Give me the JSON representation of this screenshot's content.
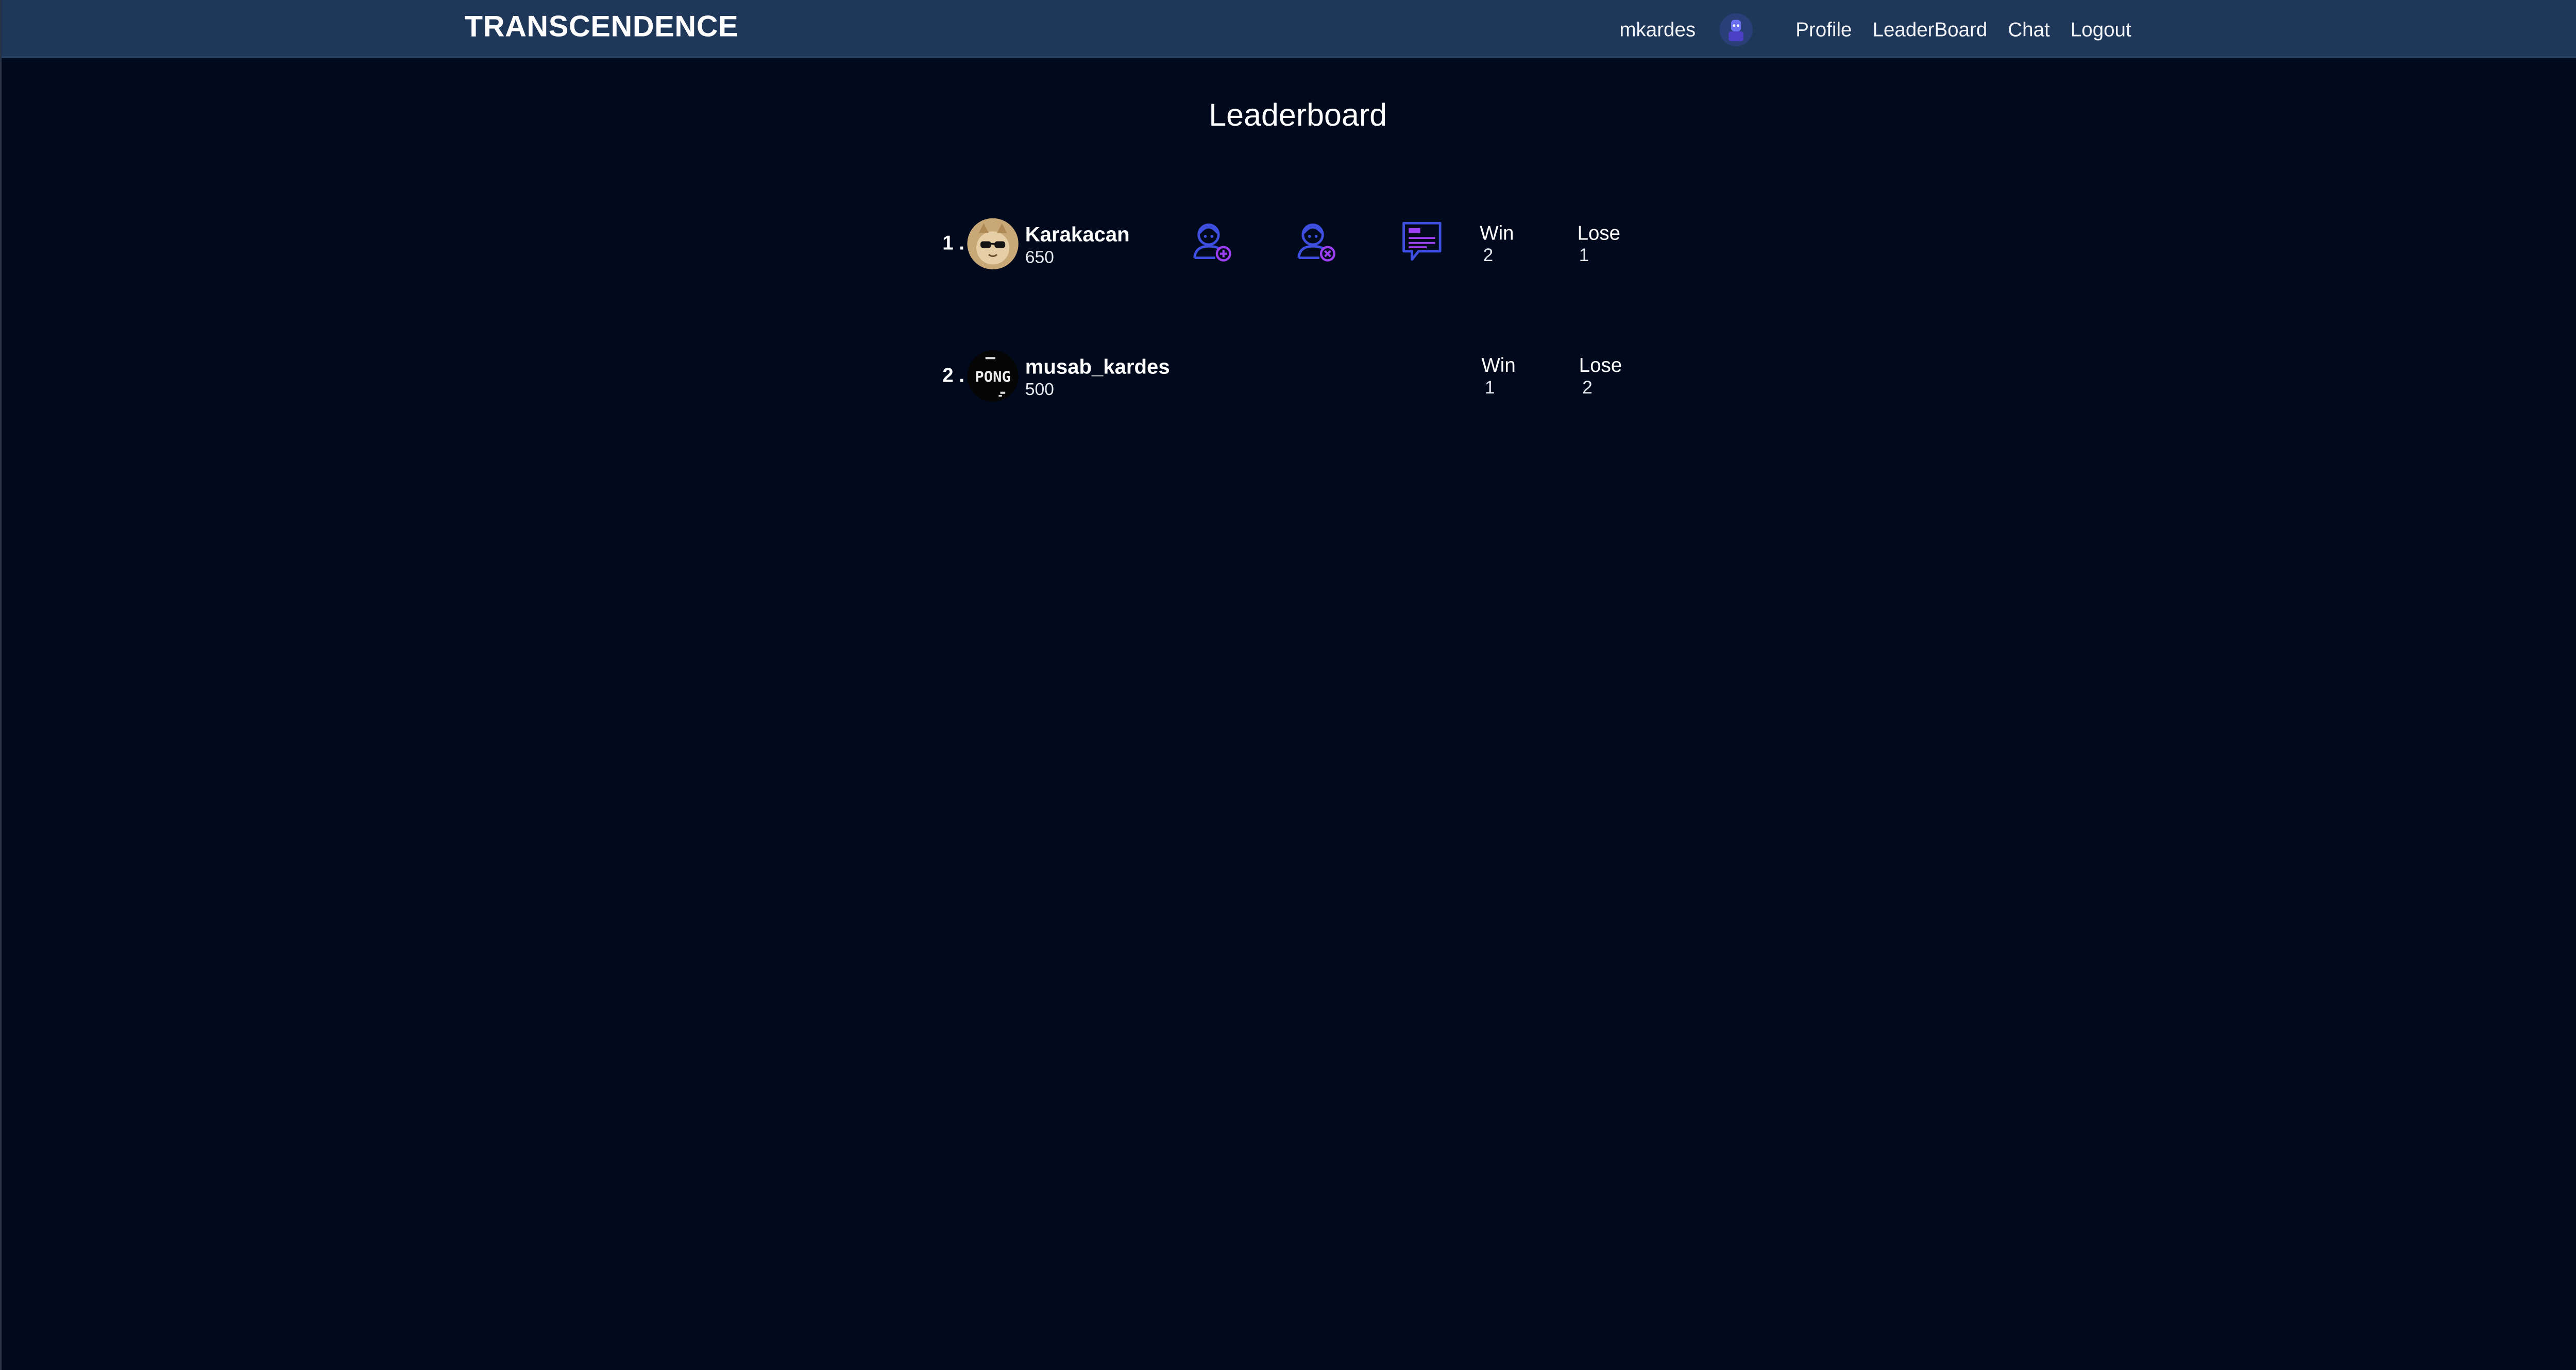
{
  "navbar": {
    "brand": "TRANSCENDENCE",
    "username": "mkardes",
    "links": [
      "Profile",
      "LeaderBoard",
      "Chat",
      "Logout"
    ]
  },
  "page": {
    "title": "Leaderboard"
  },
  "leaderboard": [
    {
      "rank": "1 .",
      "name": "Karakacan",
      "score": "650",
      "win_label": "Win",
      "win": "2",
      "lose_label": "Lose",
      "lose": "1",
      "actions": [
        "add-friend-icon",
        "block-user-icon",
        "message-icon"
      ]
    },
    {
      "rank": "2 .",
      "name": "musab_kardes",
      "score": "500",
      "avatar_text": "PONG",
      "win_label": "Win",
      "win": "1",
      "lose_label": "Lose",
      "lose": "2"
    }
  ],
  "colors": {
    "navbar_bg": "#1f3759",
    "page_bg": "#010a1c",
    "icon_blue": "#3e4fe0",
    "icon_purple": "#9b3df0"
  }
}
